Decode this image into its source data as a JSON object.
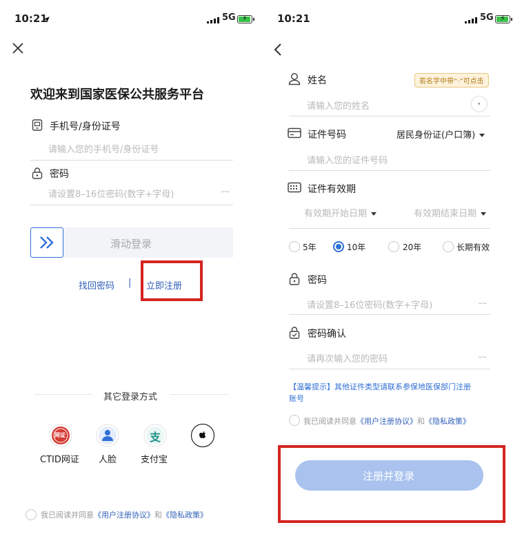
{
  "login": {
    "status": {
      "time": "10:21",
      "network": "5G"
    },
    "title": "欢迎来到国家医保公共服务平台",
    "phone_label": "手机号/身份证号",
    "phone_placeholder": "请输入您的手机号/身份证号",
    "password_label": "密码",
    "password_placeholder": "请设置8–16位密码(数字+字母)",
    "slider_text": "滑动登录",
    "forgot_password": "找回密码",
    "separator": "|",
    "register_now": "立即注册",
    "other_methods": "其它登录方式",
    "methods": [
      {
        "label": "CTID网证",
        "icon": "ctid-icon",
        "badge": "网证"
      },
      {
        "label": "人脸",
        "icon": "face-icon"
      },
      {
        "label": "支付宝",
        "icon": "alipay-icon",
        "glyph": "支"
      },
      {
        "label": "",
        "icon": "apple-icon"
      }
    ],
    "agree_prefix": "我已阅读并同意",
    "agree_link1": "《用户注册协议》",
    "agree_and": "和",
    "agree_link2": "《隐私政策》"
  },
  "register": {
    "status": {
      "time": "10:21",
      "network": "5G"
    },
    "name_label": "姓名",
    "name_tip": "若名字中带“·”可点击",
    "name_placeholder": "请输入您的姓名",
    "dot_button": "·",
    "id_label": "证件号码",
    "id_type": "居民身份证(户口簿)",
    "id_placeholder": "请输入您的证件号码",
    "validity_label": "证件有效期",
    "validity_start": "有效期开始日期",
    "validity_end": "有效期结束日期",
    "durations": [
      {
        "label": "5年",
        "selected": false
      },
      {
        "label": "10年",
        "selected": true
      },
      {
        "label": "20年",
        "selected": false
      },
      {
        "label": "长期有效",
        "selected": false
      }
    ],
    "password_label": "密码",
    "password_placeholder": "请设置8–16位密码(数字+字母)",
    "confirm_label": "密码确认",
    "confirm_placeholder": "请再次输入您的密码",
    "tip_line1": "【温馨提示】其他证件类型请联系参保地医保部门注册",
    "tip_line2": "账号",
    "agree_prefix": "我已阅读并同意",
    "agree_link1": "《用户注册协议》",
    "agree_and": "和",
    "agree_link2": "《隐私政策》",
    "submit": "注册并登录"
  },
  "colors": {
    "accent": "#2f6fd6",
    "link": "#2f5fb8",
    "highlight": "#d42420",
    "button_disabled": "#a9c2ee"
  }
}
